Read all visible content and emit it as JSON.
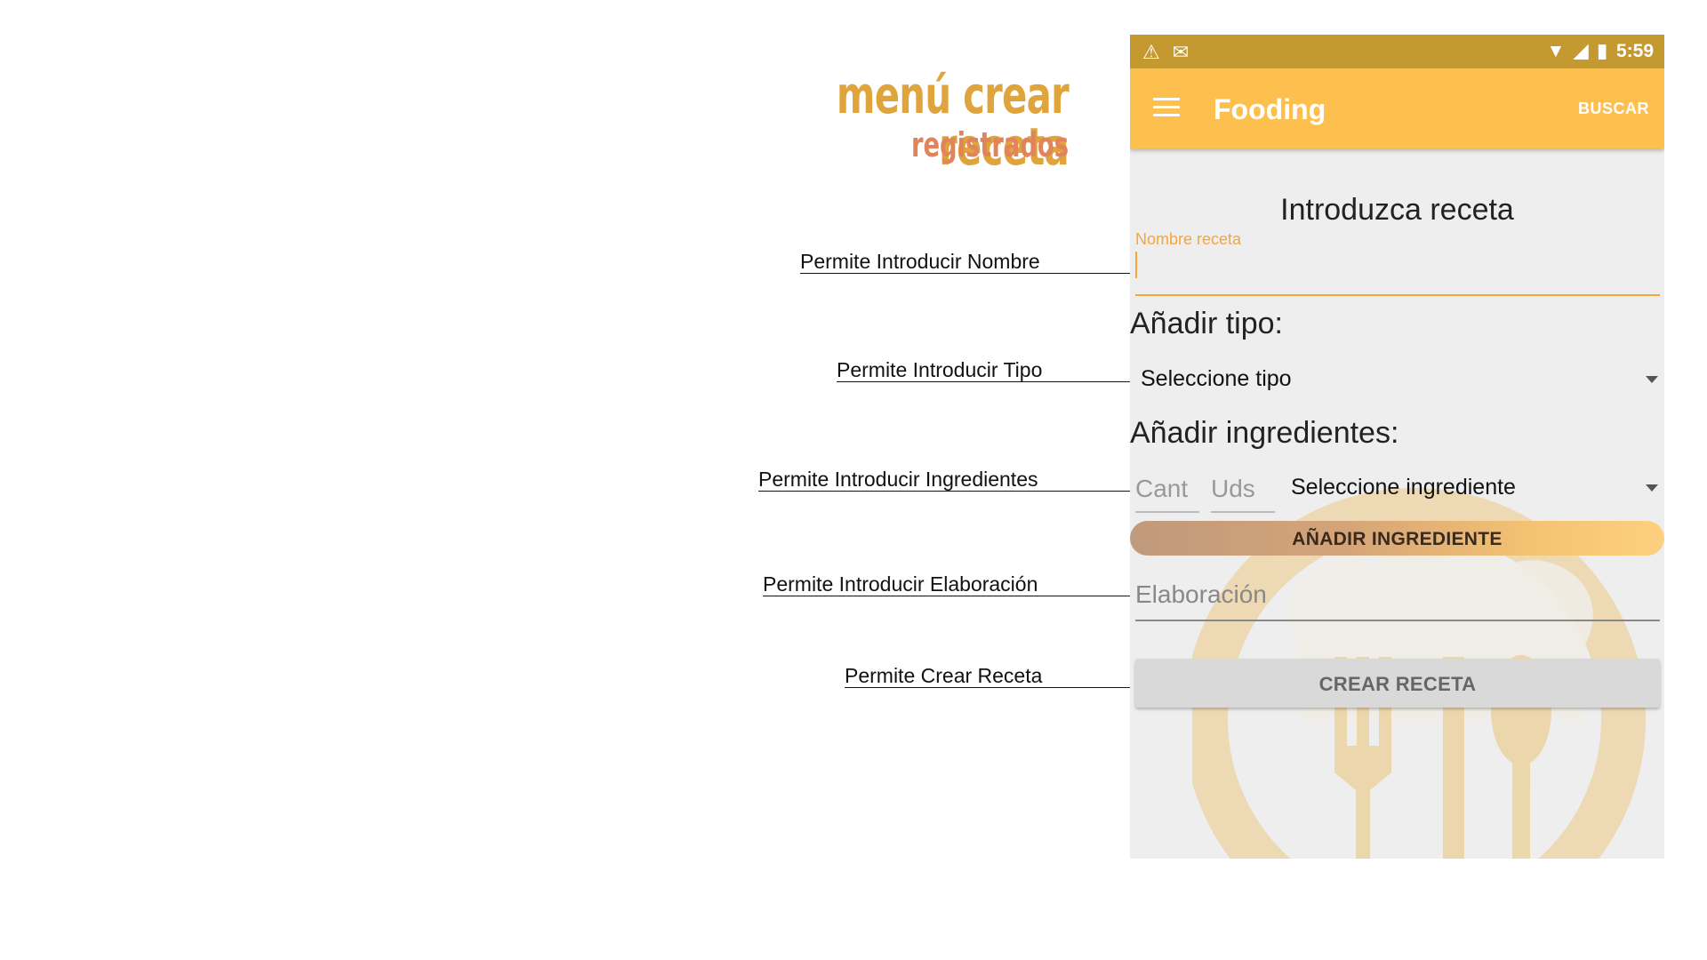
{
  "heading": {
    "title": "menú crear receta",
    "subtitle": "registrados"
  },
  "annotations": [
    "Permite Introducir Nombre",
    "Permite Introducir Tipo",
    "Permite Introducir Ingredientes",
    "Permite Introducir Elaboración",
    "Permite Crear Receta"
  ],
  "status_bar": {
    "time": "5:59",
    "left_icons": [
      "warning-icon",
      "mail-icon"
    ],
    "right_icons": [
      "wifi-icon",
      "signal-icon",
      "battery-icon"
    ]
  },
  "app_bar": {
    "title": "Fooding",
    "action": "BUSCAR",
    "menu_icon": "menu-icon"
  },
  "form": {
    "title": "Introduzca receta",
    "name_label": "Nombre receta",
    "tipo_section": "Añadir tipo:",
    "tipo_spinner": "Seleccione tipo",
    "ingredientes_section": "Añadir ingredientes:",
    "cant_placeholder": "Cant",
    "uds_placeholder": "Uds",
    "ingrediente_spinner": "Seleccione ingrediente",
    "add_ingredient_button": "AÑADIR INGREDIENTE",
    "elaboracion_placeholder": "Elaboración",
    "create_button": "CREAR RECETA"
  },
  "colors": {
    "status_bar": "#c49a30",
    "app_bar": "#fdc04f",
    "accent": "#f6a53c",
    "heading": "#e0a43c",
    "subheading": "#e0845a",
    "screen_background": "#eeeeee"
  }
}
